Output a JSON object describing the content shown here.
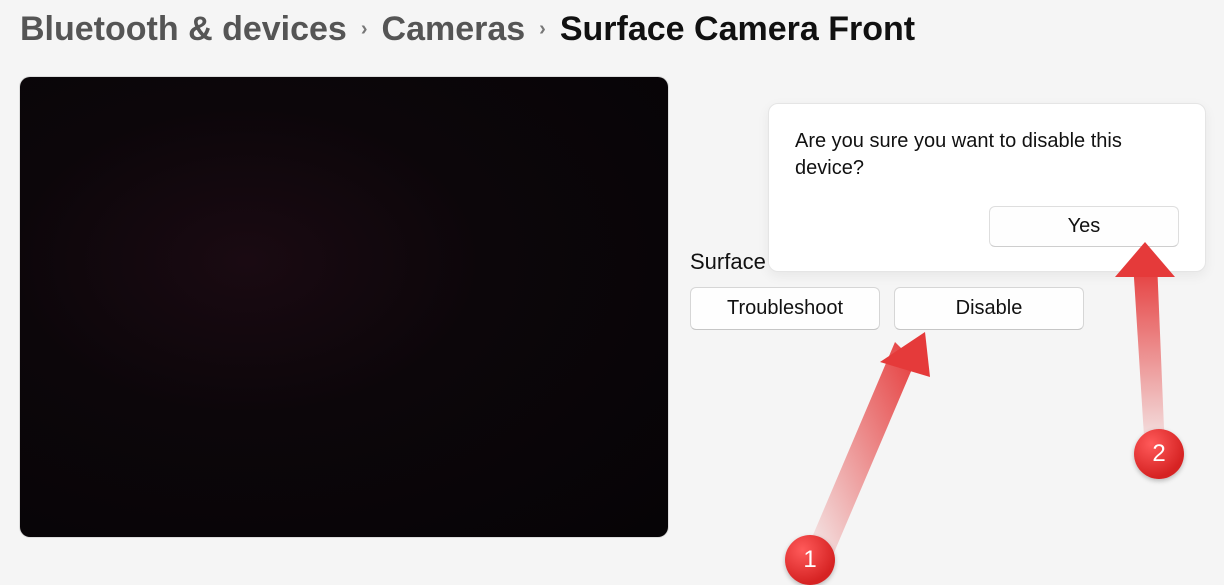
{
  "breadcrumb": {
    "level1": "Bluetooth & devices",
    "level2": "Cameras",
    "current": "Surface Camera Front"
  },
  "device": {
    "name_partial": "Surface"
  },
  "buttons": {
    "troubleshoot": "Troubleshoot",
    "disable": "Disable"
  },
  "dialog": {
    "message": "Are you sure you want to disable this device?",
    "confirm": "Yes"
  },
  "annotations": {
    "n1": "1",
    "n2": "2"
  }
}
